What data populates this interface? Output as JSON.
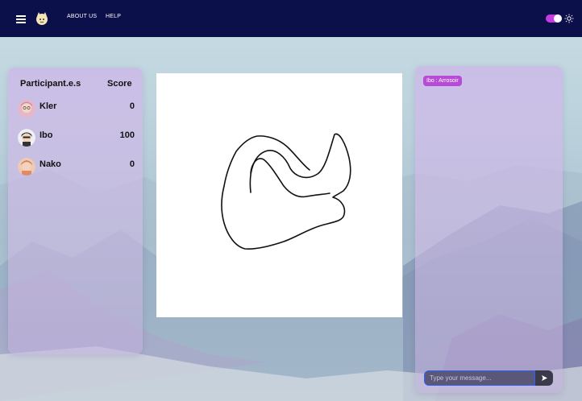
{
  "nav": {
    "about_label": "ABOUT US",
    "help_label": "HELP"
  },
  "scoreboard": {
    "participants_header": "Participant.e.s",
    "score_header": "Score",
    "players": [
      {
        "name": "Kler",
        "score": "0"
      },
      {
        "name": "Ibo",
        "score": "100"
      },
      {
        "name": "Nako",
        "score": "0"
      }
    ]
  },
  "chat": {
    "messages": [
      {
        "text": "Ibo : Arrosoir"
      }
    ],
    "placeholder": "Type your message..."
  },
  "theme": {
    "navbar": "#0b0f4a",
    "accent": "#c23ce0",
    "chat_bubble": "#b64bd6",
    "input_border": "#2b62ff"
  },
  "icons": {
    "menu": "hamburger-icon",
    "logo": "cat-logo-icon",
    "theme": "sun-icon",
    "send": "send-icon"
  }
}
